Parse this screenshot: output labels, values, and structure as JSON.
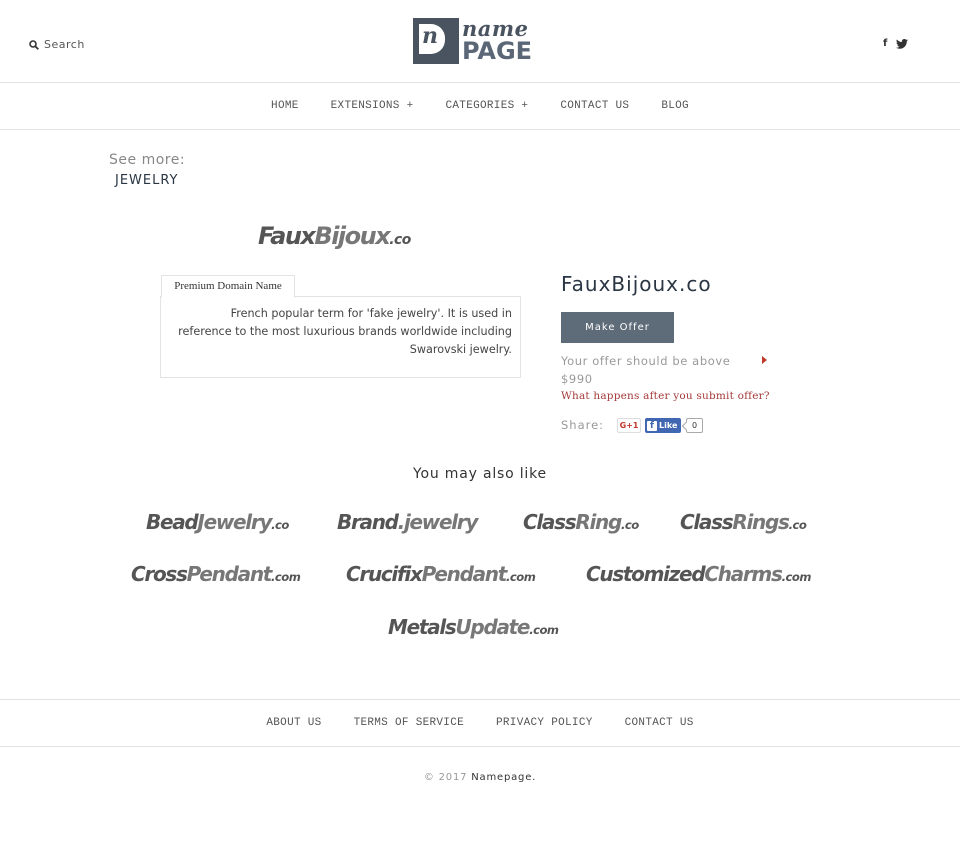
{
  "header": {
    "search_label": "Search",
    "logo": {
      "box_letter": "n",
      "line1": "name",
      "line2": "PAGE"
    },
    "social": [
      {
        "icon": "facebook-icon",
        "glyph": "f"
      },
      {
        "icon": "twitter-icon"
      }
    ]
  },
  "nav": {
    "items": [
      {
        "label": "HOME"
      },
      {
        "label": "EXTENSIONS +"
      },
      {
        "label": "CATEGORIES +"
      },
      {
        "label": "CONTACT US"
      },
      {
        "label": "BLOG"
      }
    ]
  },
  "see_more": {
    "label": "See more:",
    "link": "JEWELRY"
  },
  "domain": {
    "logo": {
      "part1": "Faux",
      "part2": "Bijoux",
      "tld": ".co"
    },
    "tab_label": "Premium Domain Name",
    "description": "French popular term for 'fake jewelry'. It is used in reference to the most luxurious brands worldwide including Swarovski jewelry.",
    "title": "FauxBijoux.co",
    "offer_button": "Make Offer",
    "offer_note": "Your offer should be above $990",
    "what_happens": "What happens after you submit offer?",
    "share_label": "Share:",
    "gplus_label": "G+1",
    "fb_like_label": "Like",
    "fb_like_count": "0"
  },
  "also_like": {
    "heading": "You may also like",
    "items": [
      {
        "part1": "Bead",
        "part2": "Jewelry",
        "tld": ".co"
      },
      {
        "part1": "Brand",
        "part2": ".jewelry",
        "tld": ""
      },
      {
        "part1": "Class",
        "part2": "Ring",
        "tld": ".co"
      },
      {
        "part1": "Class",
        "part2": "Rings",
        "tld": ".co"
      },
      {
        "part1": "Cross",
        "part2": "Pendant",
        "tld": ".com"
      },
      {
        "part1": "Crucifix",
        "part2": "Pendant",
        "tld": ".com"
      },
      {
        "part1": "Customized",
        "part2": "Charms",
        "tld": ".com"
      },
      {
        "part1": "Metals",
        "part2": "Update",
        "tld": ".com"
      }
    ]
  },
  "footer": {
    "links": [
      {
        "label": "ABOUT US"
      },
      {
        "label": "TERMS OF SERVICE"
      },
      {
        "label": "PRIVACY POLICY"
      },
      {
        "label": "CONTACT US"
      }
    ],
    "copyright_prefix": "© 2017",
    "copyright_brand": "Namepage."
  },
  "colors": {
    "brand": "#4a5461",
    "button": "#5e6b78",
    "title": "#2a3644",
    "link_red": "#a43a3a",
    "facebook": "#4267b2"
  }
}
